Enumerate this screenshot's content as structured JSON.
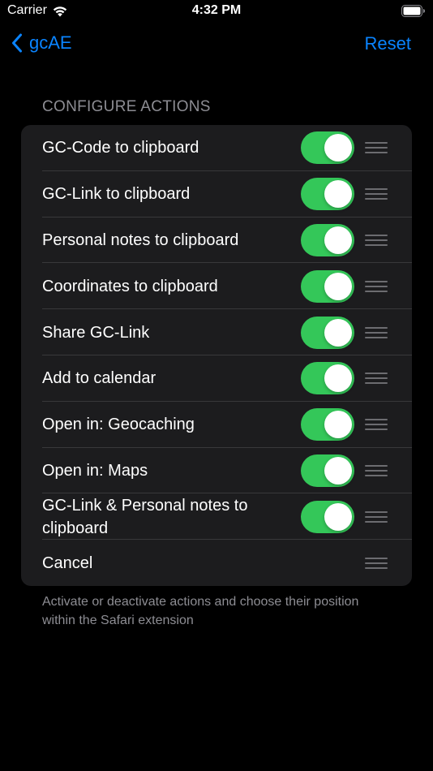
{
  "status_bar": {
    "carrier": "Carrier",
    "time": "4:32 PM"
  },
  "nav": {
    "back_label": "gcAE",
    "reset_label": "Reset"
  },
  "section_header": "CONFIGURE ACTIONS",
  "actions": [
    {
      "label": "GC-Code to clipboard",
      "enabled": true
    },
    {
      "label": "GC-Link to clipboard",
      "enabled": true
    },
    {
      "label": "Personal notes to clipboard",
      "enabled": true
    },
    {
      "label": "Coordinates to clipboard",
      "enabled": true
    },
    {
      "label": "Share GC-Link",
      "enabled": true
    },
    {
      "label": "Add to calendar",
      "enabled": true
    },
    {
      "label": "Open in: Geocaching",
      "enabled": true
    },
    {
      "label": "Open in: Maps",
      "enabled": true
    },
    {
      "label": "GC-Link & Personal notes to clipboard",
      "enabled": true
    },
    {
      "label": "Cancel",
      "enabled": null
    }
  ],
  "footer": "Activate or deactivate actions and choose their position within the Safari extension",
  "colors": {
    "accent": "#0a84ff",
    "toggle_on": "#34c759",
    "card_background": "#1c1c1e",
    "background": "#000000",
    "secondary_text": "#8d8d93"
  }
}
